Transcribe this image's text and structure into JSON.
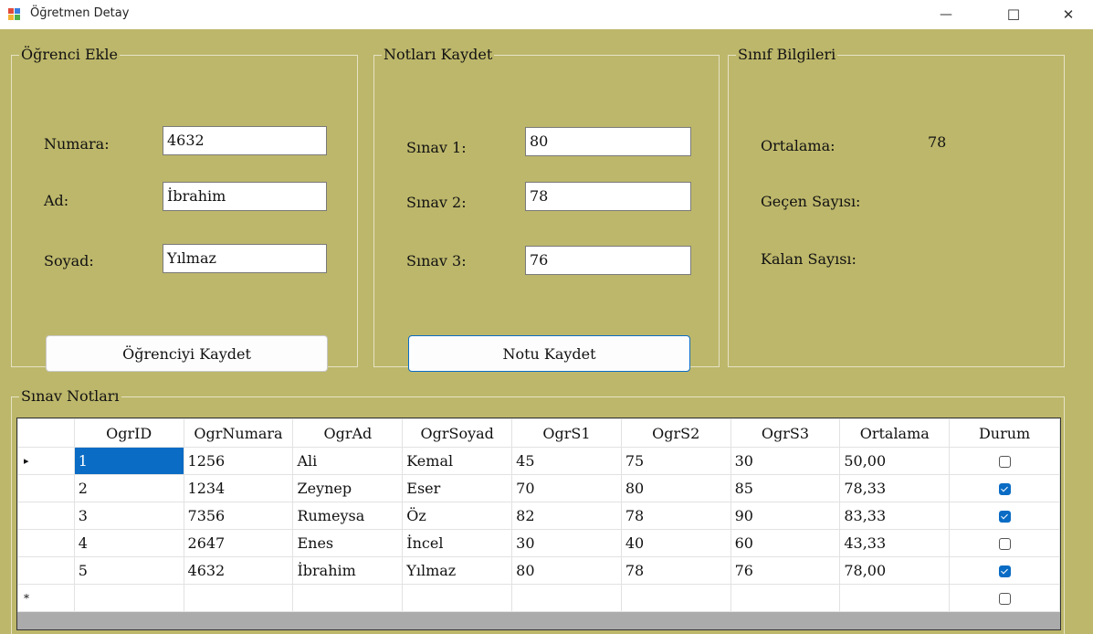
{
  "window": {
    "title": "Öğretmen Detay",
    "minimize": "—",
    "maximize": "☐",
    "close": "✕"
  },
  "ogrenci_ekle": {
    "title": "Öğrenci Ekle",
    "numara_label": "Numara:",
    "numara_value": "4632",
    "ad_label": "Ad:",
    "ad_value": "İbrahim",
    "soyad_label": "Soyad:",
    "soyad_value": "Yılmaz",
    "save_button": "Öğrenciyi Kaydet"
  },
  "notlari_kaydet": {
    "title": "Notları Kaydet",
    "sinav1_label": "Sınav 1:",
    "sinav1_value": "80",
    "sinav2_label": "Sınav 2:",
    "sinav2_value": "78",
    "sinav3_label": "Sınav 3:",
    "sinav3_value": "76",
    "save_button": "Notu Kaydet"
  },
  "sinif_bilgileri": {
    "title": "Sınıf Bilgileri",
    "ortalama_label": "Ortalama:",
    "ortalama_value": "78",
    "gecen_label": "Geçen Sayısı:",
    "kalan_label": "Kalan Sayısı:"
  },
  "sinav_notlari": {
    "title": "Sınav Notları",
    "columns": [
      "OgrID",
      "OgrNumara",
      "OgrAd",
      "OgrSoyad",
      "OgrS1",
      "OgrS2",
      "OgrS3",
      "Ortalama",
      "Durum"
    ],
    "rows": [
      {
        "indicator": "▸",
        "cells": [
          "1",
          "1256",
          "Ali",
          "Kemal",
          "45",
          "75",
          "30",
          "50,00"
        ],
        "durum": false
      },
      {
        "indicator": "",
        "cells": [
          "2",
          "1234",
          "Zeynep",
          "Eser",
          "70",
          "80",
          "85",
          "78,33"
        ],
        "durum": true
      },
      {
        "indicator": "",
        "cells": [
          "3",
          "7356",
          "Rumeysa",
          "Öz",
          "82",
          "78",
          "90",
          "83,33"
        ],
        "durum": true
      },
      {
        "indicator": "",
        "cells": [
          "4",
          "2647",
          "Enes",
          "İncel",
          "30",
          "40",
          "60",
          "43,33"
        ],
        "durum": false
      },
      {
        "indicator": "",
        "cells": [
          "5",
          "4632",
          "İbrahim",
          "Yılmaz",
          "80",
          "78",
          "76",
          "78,00"
        ],
        "durum": true
      }
    ],
    "new_row_indicator": "*"
  },
  "colors": {
    "form_bg": "#bdb76b",
    "selection": "#0a6cc4"
  }
}
